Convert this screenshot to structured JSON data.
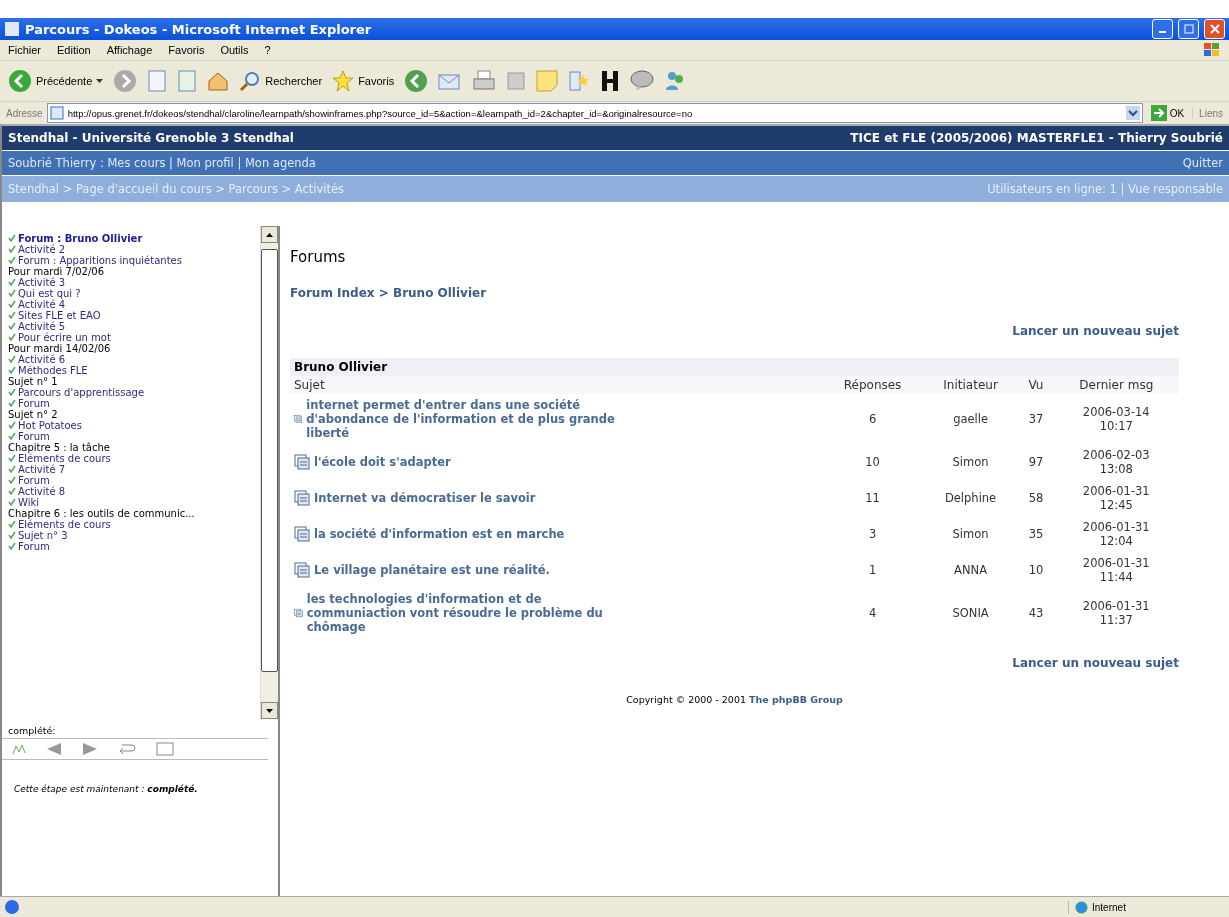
{
  "window": {
    "title": "Parcours - Dokeos - Microsoft Internet Explorer"
  },
  "menu": [
    "Fichier",
    "Edition",
    "Affichage",
    "Favoris",
    "Outils",
    "?"
  ],
  "toolbar": {
    "back": "Précédente",
    "search": "Rechercher",
    "favorites": "Favoris"
  },
  "address": {
    "label": "Adresse",
    "value": "http://opus.grenet.fr/dokeos/stendhal/claroline/learnpath/showinframes.php?source_id=5&action=&learnpath_id=2&chapter_id=&originalresource=no",
    "go": "OK",
    "links": "Liens"
  },
  "header": {
    "site": "Stendhal - Université Grenoble 3 Stendhal",
    "course": "TICE et FLE (2005/2006) MASTERFLE1 - Thierry Soubrié",
    "user_links": "Soubrié Thierry : Mes cours | Mon profil | Mon agenda",
    "logout": "Quitter",
    "breadcrumb": "Stendhal > Page d'accueil du cours > Parcours > Activités",
    "online": "Utilisateurs en ligne: 1 |  Vue responsable"
  },
  "sidebar": {
    "items": [
      {
        "kind": "step",
        "label": "Forum : Bruno Ollivier",
        "selected": true
      },
      {
        "kind": "step",
        "label": "Activité 2",
        "selected": false
      },
      {
        "kind": "step",
        "label": "Forum : Apparitions inquiétantes",
        "selected": false
      },
      {
        "kind": "chapter",
        "label": "Pour mardi 7/02/06"
      },
      {
        "kind": "step",
        "label": "Activité 3",
        "selected": false
      },
      {
        "kind": "step",
        "label": "Qui est qui ?",
        "selected": false
      },
      {
        "kind": "step",
        "label": "Activité 4",
        "selected": false
      },
      {
        "kind": "step",
        "label": "Sites FLE et EAO",
        "selected": false
      },
      {
        "kind": "step",
        "label": "Activité 5",
        "selected": false
      },
      {
        "kind": "step",
        "label": "Pour écrire un mot",
        "selected": false
      },
      {
        "kind": "chapter",
        "label": "Pour mardi 14/02/06"
      },
      {
        "kind": "step",
        "label": "Activité 6",
        "selected": false
      },
      {
        "kind": "step",
        "label": "Méthodes FLE",
        "selected": false
      },
      {
        "kind": "chapter",
        "label": "Sujet n° 1"
      },
      {
        "kind": "step",
        "label": "Parcours d'apprentissage",
        "selected": false
      },
      {
        "kind": "step",
        "label": "Forum",
        "selected": false
      },
      {
        "kind": "chapter",
        "label": "Sujet n° 2"
      },
      {
        "kind": "step",
        "label": "Hot Potatoes",
        "selected": false
      },
      {
        "kind": "step",
        "label": "Forum",
        "selected": false
      },
      {
        "kind": "chapter",
        "label": "Chapitre 5 : la tâche"
      },
      {
        "kind": "step",
        "label": "Eléments de cours",
        "selected": false
      },
      {
        "kind": "step",
        "label": "Activité 7",
        "selected": false
      },
      {
        "kind": "step",
        "label": "Forum",
        "selected": false
      },
      {
        "kind": "step",
        "label": "Activité 8",
        "selected": false
      },
      {
        "kind": "step",
        "label": "Wiki",
        "selected": false
      },
      {
        "kind": "chapter",
        "label": "Chapitre 6 : les outils de communic..."
      },
      {
        "kind": "step",
        "label": "Eléments de cours",
        "selected": false
      },
      {
        "kind": "step",
        "label": "Sujet n° 3",
        "selected": false
      },
      {
        "kind": "step",
        "label": "Forum",
        "selected": false
      }
    ],
    "progress_label": "complété:",
    "message": "*Cette étape est maintenant :* **complété.**"
  },
  "content": {
    "title": "Forums",
    "breadcrumb": "Forum Index > Bruno Ollivier",
    "new_topic": "Lancer un nouveau sujet",
    "forum_name": "Bruno Ollivier",
    "columns": [
      "Sujet",
      "Réponses",
      "Initiateur",
      "Vu",
      "Dernier msg"
    ],
    "rows": [
      {
        "subject": "internet permet d'entrer dans une société d'abondance de l'information et de plus grande liberté",
        "replies": "6",
        "author": "gaelle",
        "views": "37",
        "last_date": "2006-03-14",
        "last_time": "10:17"
      },
      {
        "subject": "l'école doit s'adapter",
        "replies": "10",
        "author": "Simon",
        "views": "97",
        "last_date": "2006-02-03",
        "last_time": "13:08"
      },
      {
        "subject": "Internet va démocratiser le savoir",
        "replies": "11",
        "author": "Delphine",
        "views": "58",
        "last_date": "2006-01-31",
        "last_time": "12:45"
      },
      {
        "subject": "la société d'information est en marche",
        "replies": "3",
        "author": "Simon",
        "views": "35",
        "last_date": "2006-01-31",
        "last_time": "12:04"
      },
      {
        "subject": "Le village planétaire est une réalité.",
        "replies": "1",
        "author": "ANNA",
        "views": "10",
        "last_date": "2006-01-31",
        "last_time": "11:44"
      },
      {
        "subject": "les technologies d'information et de communiaction vont résoudre le problème du chômage",
        "replies": "4",
        "author": "SONIA",
        "views": "43",
        "last_date": "2006-01-31",
        "last_time": "11:37"
      }
    ],
    "new_topic_bottom": "Lancer un nouveau sujet",
    "copyright": "Copyright © 2000 - 2001",
    "copyright_link": "The phpBB Group"
  },
  "status_bar": {
    "zone": "Internet"
  }
}
